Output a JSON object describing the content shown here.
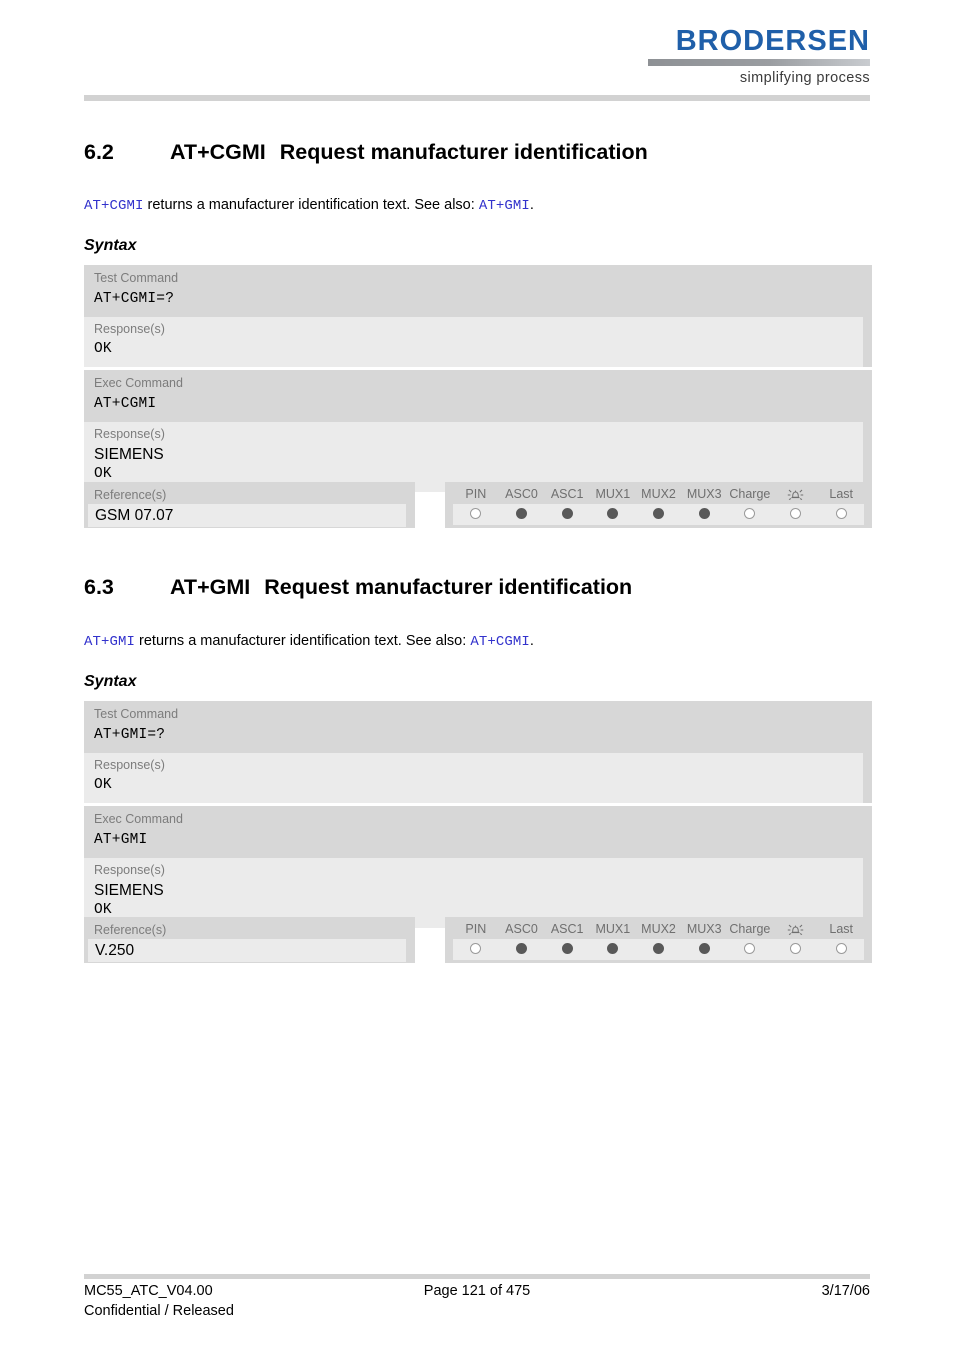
{
  "header": {
    "logo_word": "BRODERSEN",
    "logo_tagline": "simplifying process",
    "logo_color": "#1F5FA9"
  },
  "sections": [
    {
      "number": "6.2",
      "command": "AT+CGMI",
      "title": "Request manufacturer identification",
      "intro": {
        "ref_start": "AT+CGMI",
        "text_mid": " returns a manufacturer identification text. See also: ",
        "ref_end": "AT+GMI",
        "text_end": "."
      },
      "syntax_label": "Syntax",
      "test_command": {
        "label": "Test Command",
        "code": "AT+CGMI=?",
        "response_label": "Response(s)",
        "response_code": "OK"
      },
      "exec_command": {
        "label": "Exec Command",
        "code": "AT+CGMI",
        "response_label": "Response(s)",
        "response_text": "SIEMENS",
        "response_code": "OK"
      },
      "reference": {
        "label": "Reference(s)",
        "value": "GSM 07.07"
      },
      "indicators": {
        "columns": [
          "PIN",
          "ASC0",
          "ASC1",
          "MUX1",
          "MUX2",
          "MUX3",
          "Charge",
          "alarm-icon",
          "Last"
        ],
        "states": [
          "empty",
          "filled",
          "filled",
          "filled",
          "filled",
          "filled",
          "empty",
          "empty",
          "empty"
        ]
      }
    },
    {
      "number": "6.3",
      "command": "AT+GMI",
      "title": "Request manufacturer identification",
      "intro": {
        "ref_start": "AT+GMI",
        "text_mid": " returns a manufacturer identification text. See also: ",
        "ref_end": "AT+CGMI",
        "text_end": "."
      },
      "syntax_label": "Syntax",
      "test_command": {
        "label": "Test Command",
        "code": "AT+GMI=?",
        "response_label": "Response(s)",
        "response_code": "OK"
      },
      "exec_command": {
        "label": "Exec Command",
        "code": "AT+GMI",
        "response_label": "Response(s)",
        "response_text": "SIEMENS",
        "response_code": "OK"
      },
      "reference": {
        "label": "Reference(s)",
        "value": "V.250"
      },
      "indicators": {
        "columns": [
          "PIN",
          "ASC0",
          "ASC1",
          "MUX1",
          "MUX2",
          "MUX3",
          "Charge",
          "alarm-icon",
          "Last"
        ],
        "states": [
          "empty",
          "filled",
          "filled",
          "filled",
          "filled",
          "filled",
          "empty",
          "empty",
          "empty"
        ]
      }
    }
  ],
  "footer": {
    "doc_id": "MC55_ATC_V04.00",
    "classification": "Confidential / Released",
    "page": "Page 121 of 475",
    "date": "3/17/06"
  }
}
